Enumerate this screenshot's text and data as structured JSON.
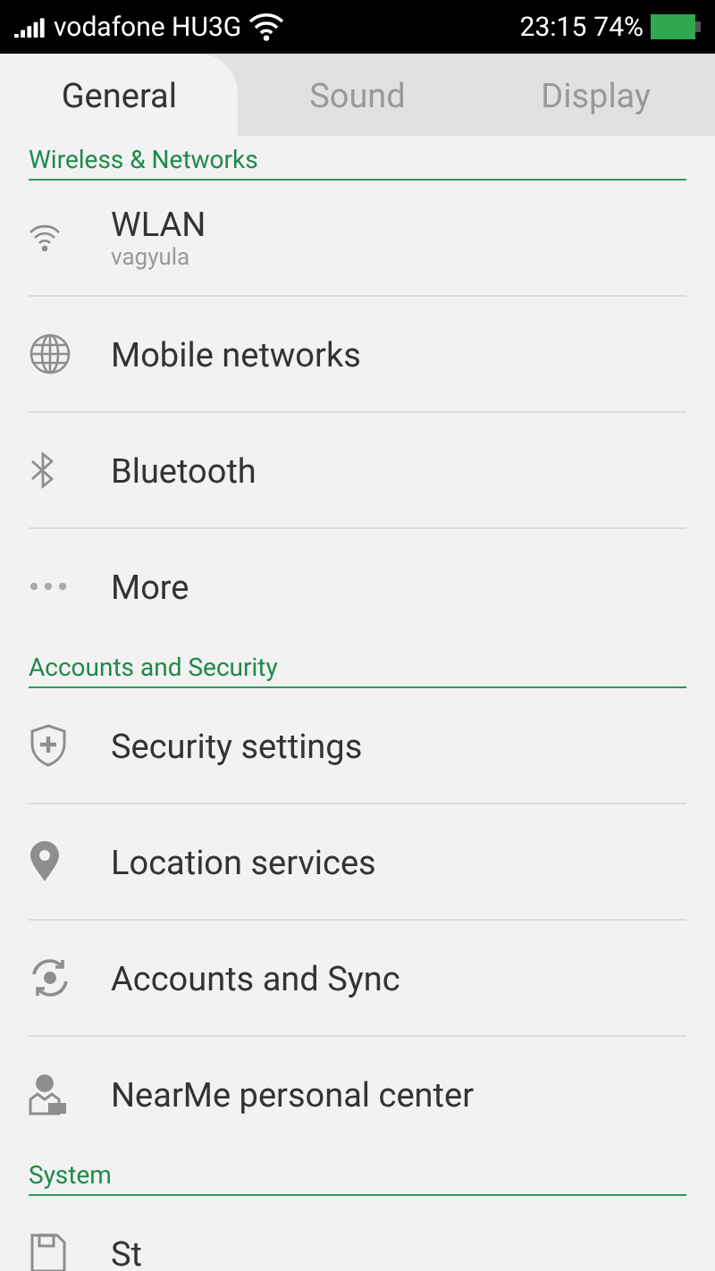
{
  "status_bar": {
    "carrier": "vodafone HU3G",
    "time": "23:15",
    "battery": "74%"
  },
  "tabs": [
    {
      "label": "General",
      "selected": true
    },
    {
      "label": "Sound",
      "selected": false
    },
    {
      "label": "Display",
      "selected": false
    }
  ],
  "sections": [
    {
      "title": "Wireless & Networks",
      "items": [
        {
          "label": "WLAN",
          "summary": "vagyula"
        },
        {
          "label": "Mobile networks"
        },
        {
          "label": "Bluetooth"
        },
        {
          "label": "More"
        }
      ]
    },
    {
      "title": "Accounts and Security",
      "items": [
        {
          "label": "Security settings"
        },
        {
          "label": "Location services"
        },
        {
          "label": "Accounts and Sync"
        },
        {
          "label": "NearMe personal center"
        }
      ]
    },
    {
      "title": "System",
      "items": [
        {
          "label": "St"
        }
      ]
    }
  ]
}
